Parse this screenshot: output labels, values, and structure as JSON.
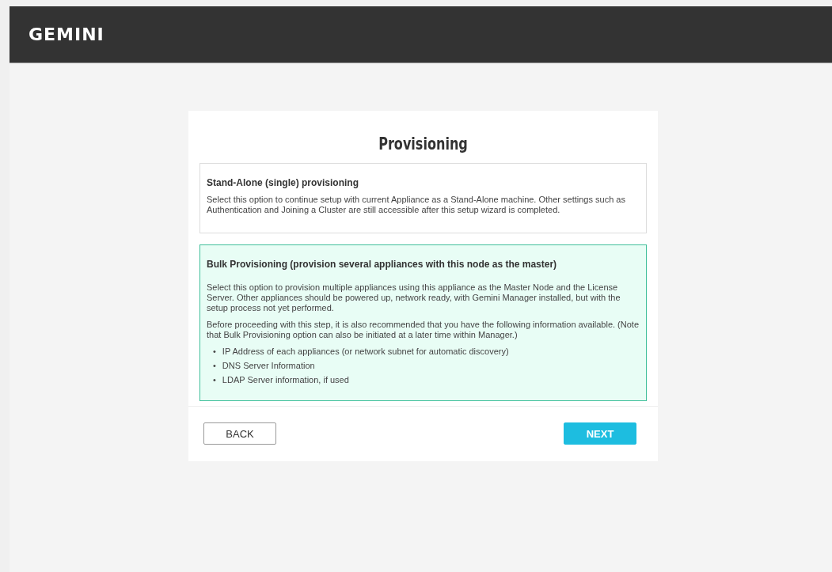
{
  "header": {
    "logo": "GEMINI"
  },
  "dialog": {
    "title": "Provisioning",
    "options": [
      {
        "title": "Stand-Alone (single) provisioning",
        "selected": false,
        "paragraphs": [
          "Select this option to continue setup with current Appliance as a Stand-Alone machine. Other settings such as Authentication and Joining a Cluster are still accessible after this setup wizard is completed."
        ]
      },
      {
        "title": "Bulk Provisioning (provision several appliances with this node as the master)",
        "selected": true,
        "paragraphs": [
          "Select this option to provision multiple appliances using this appliance as the Master Node and the License Server. Other appliances should be powered up, network ready, with Gemini Manager installed, but with the setup process not yet performed.",
          "Before proceeding with this step, it is also recommended that you have the following information available. (Note that Bulk Provisioning option can also be initiated at a later time within Manager.)"
        ],
        "bullets": [
          {
            "marker": "•",
            "text": "IP Address of each appliances (or network subnet for automatic discovery)"
          },
          {
            "marker": "•",
            "text": "DNS Server Information"
          },
          {
            "marker": "•",
            "text": "LDAP Server information, if used"
          }
        ]
      }
    ],
    "buttons": [
      {
        "label": "BACK",
        "kind": "secondary"
      },
      {
        "label": "NEXT",
        "kind": "primary"
      }
    ]
  }
}
